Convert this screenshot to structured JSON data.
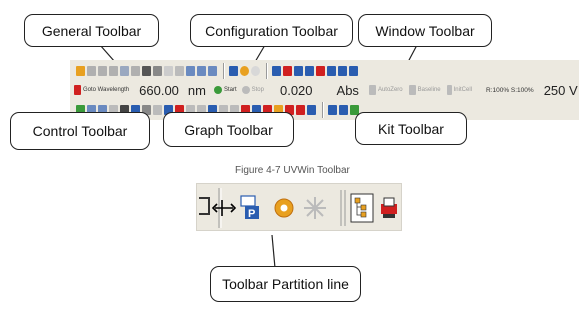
{
  "callouts": {
    "general": "General Toolbar",
    "configuration": "Configuration Toolbar",
    "window": "Window Toolbar",
    "control": "Control Toolbar",
    "graph": "Graph Toolbar",
    "kit": "Kit Toolbar",
    "partition": "Toolbar Partition line"
  },
  "toolbar": {
    "goto_label": "Goto Wavelength",
    "wavelength_value": "660.00",
    "wavelength_unit": "nm",
    "start_label": "Start",
    "stop_label": "Stop",
    "abs_value": "0.020",
    "abs_unit": "Abs",
    "autozero_label": "AutoZero",
    "baseline_label": "Baseline",
    "initcell_label": "InitCell",
    "status_text": "R:100% S:100%",
    "voltage": "250 V"
  },
  "caption": "Figure 4-7 UVWin Toolbar",
  "colors": {
    "toolbar_bg": "#ece9e0",
    "accent_orange": "#e8a020",
    "icon_blue": "#2a5db0",
    "icon_green": "#3a9a3a",
    "icon_red": "#d02020"
  }
}
